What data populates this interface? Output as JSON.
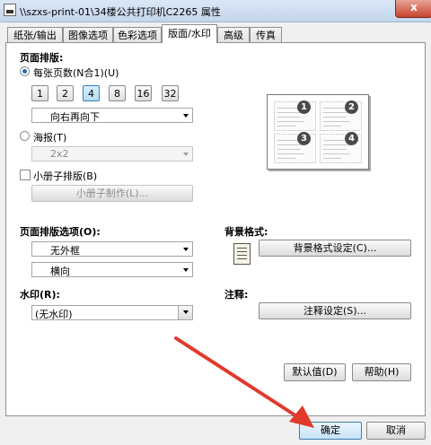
{
  "window": {
    "title": "\\\\szxs-print-01\\34楼公共打印机C2265 属性",
    "close_glyph": "x"
  },
  "tabs": [
    "纸张/输出",
    "图像选项",
    "色彩选项",
    "版面/水印",
    "高级",
    "传真"
  ],
  "layout": {
    "heading": "页面排版:",
    "pages_per_sheet_label": "每张页数(N合1)(U)",
    "nup_options": [
      "1",
      "2",
      "4",
      "8",
      "16",
      "32"
    ],
    "nup_selected": "4",
    "order_value": "向右再向下",
    "poster_label": "海报(T)",
    "poster_value": "2x2",
    "booklet_label": "小册子排版(B)",
    "booklet_button": "小册子制作(L)..."
  },
  "preview": {
    "page_numbers": [
      "1",
      "2",
      "3",
      "4"
    ]
  },
  "page_layout_options": {
    "heading": "页面排版选项(O):",
    "border_value": "无外框",
    "orientation_value": "横向"
  },
  "watermark": {
    "heading": "水印(R):",
    "value": "(无水印)"
  },
  "background": {
    "heading": "背景格式:",
    "button": "背景格式设定(C)..."
  },
  "annotation": {
    "heading": "注释:",
    "button": "注释设定(S)..."
  },
  "panel_buttons": {
    "defaults": "默认值(D)",
    "help": "帮助(H)"
  },
  "dialog_buttons": {
    "ok": "确定",
    "cancel": "取消"
  },
  "annotation_arrow_color": "#e03a2c"
}
